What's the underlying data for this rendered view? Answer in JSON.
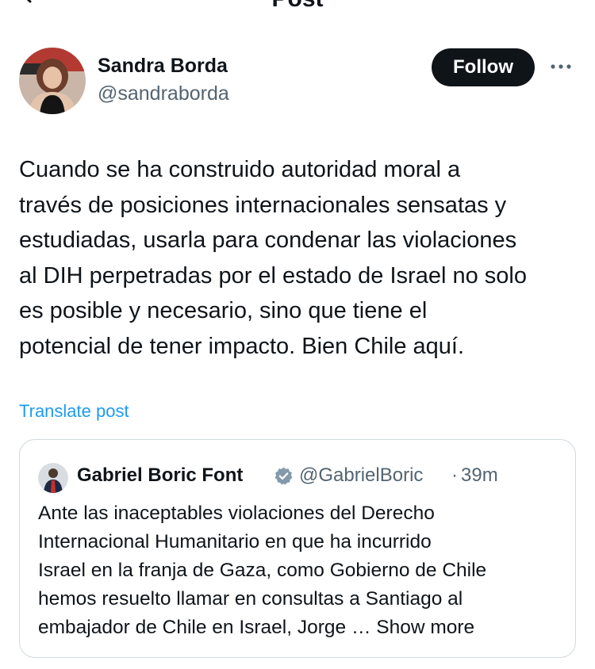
{
  "header": {
    "title": "Post",
    "back_icon": "arrow-left-icon"
  },
  "author": {
    "name": "Sandra Borda",
    "handle": "@sandraborda",
    "follow_label": "Follow",
    "more_icon": "more-horizontal-icon"
  },
  "post": {
    "text": "Cuando se ha construido autoridad moral a\ntravés de posiciones internacionales sensatas y\nestudiadas, usarla para condenar las violaciones\nal DIH perpetradas por el estado de Israel no solo\nes posible y necesario, sino que tiene el\npotencial de tener impacto. Bien Chile aquí.",
    "translate_label": "Translate post"
  },
  "quote": {
    "name": "Gabriel Boric Font",
    "verified_icon": "verified-badge-icon",
    "handle": "@GabrielBoric",
    "separator": "·",
    "time": "39m",
    "text": "Ante las inaceptables violaciones del Derecho\nInternacional Humanitario en que ha incurrido\nIsrael en la franja de Gaza, como Gobierno de Chile\nhemos resuelto llamar en consultas a Santiago al\nembajador de Chile en Israel, Jorge … ",
    "show_more": "Show more"
  },
  "colors": {
    "link": "#1d9bf0",
    "secondary_text": "#536471",
    "primary_text": "#0f1419",
    "border": "#cfd9de",
    "verified_grey": "#829aab"
  }
}
